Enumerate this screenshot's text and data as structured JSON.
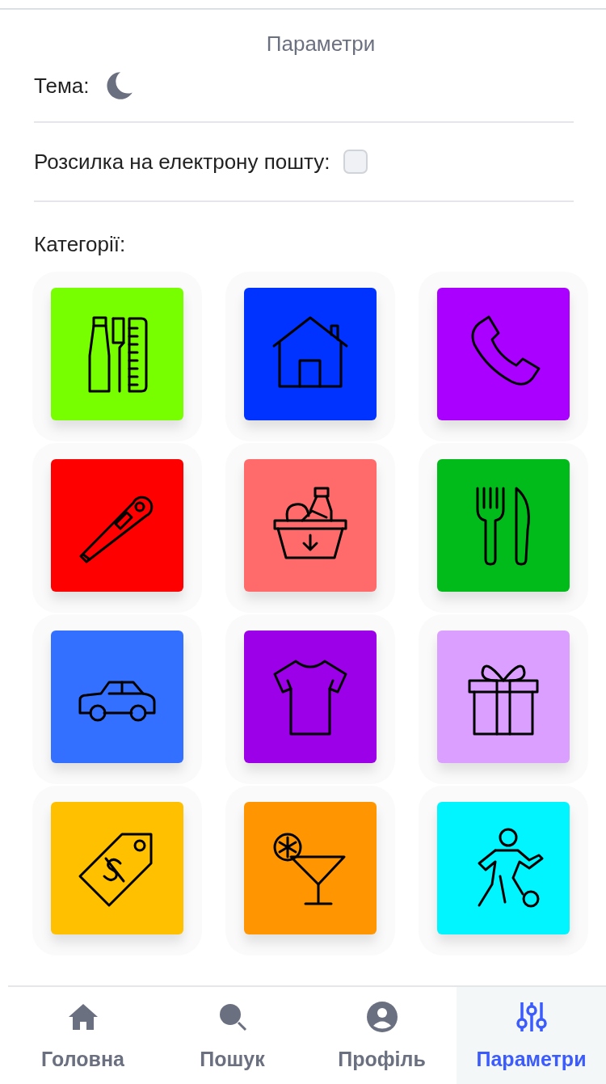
{
  "header": {
    "title": "Параметри"
  },
  "theme": {
    "label": "Тема:",
    "dark_mode": true
  },
  "newsletter": {
    "label": "Розсилка на електрону пошту:",
    "checked": false
  },
  "categories": {
    "label": "Категорії:",
    "items": [
      {
        "kind": "toiletries",
        "color": "#77ff00"
      },
      {
        "kind": "house",
        "color": "#0033ff"
      },
      {
        "kind": "phone",
        "color": "#aa00ff"
      },
      {
        "kind": "thermometer",
        "color": "#ff0000"
      },
      {
        "kind": "groceries",
        "color": "#ff6b6b"
      },
      {
        "kind": "cutlery",
        "color": "#00bb1a"
      },
      {
        "kind": "car",
        "color": "#3370ff"
      },
      {
        "kind": "shirt",
        "color": "#9b00e8"
      },
      {
        "kind": "gift",
        "color": "#dba0ff"
      },
      {
        "kind": "tag",
        "color": "#ffc000"
      },
      {
        "kind": "cocktail",
        "color": "#ff9500"
      },
      {
        "kind": "football",
        "color": "#00f5ff"
      }
    ]
  },
  "nav": [
    {
      "kind": "home",
      "label": "Головна",
      "selected": false
    },
    {
      "kind": "search",
      "label": "Пошук",
      "selected": false
    },
    {
      "kind": "profile",
      "label": "Профіль",
      "selected": false
    },
    {
      "kind": "settings",
      "label": "Параметри",
      "selected": true
    }
  ]
}
